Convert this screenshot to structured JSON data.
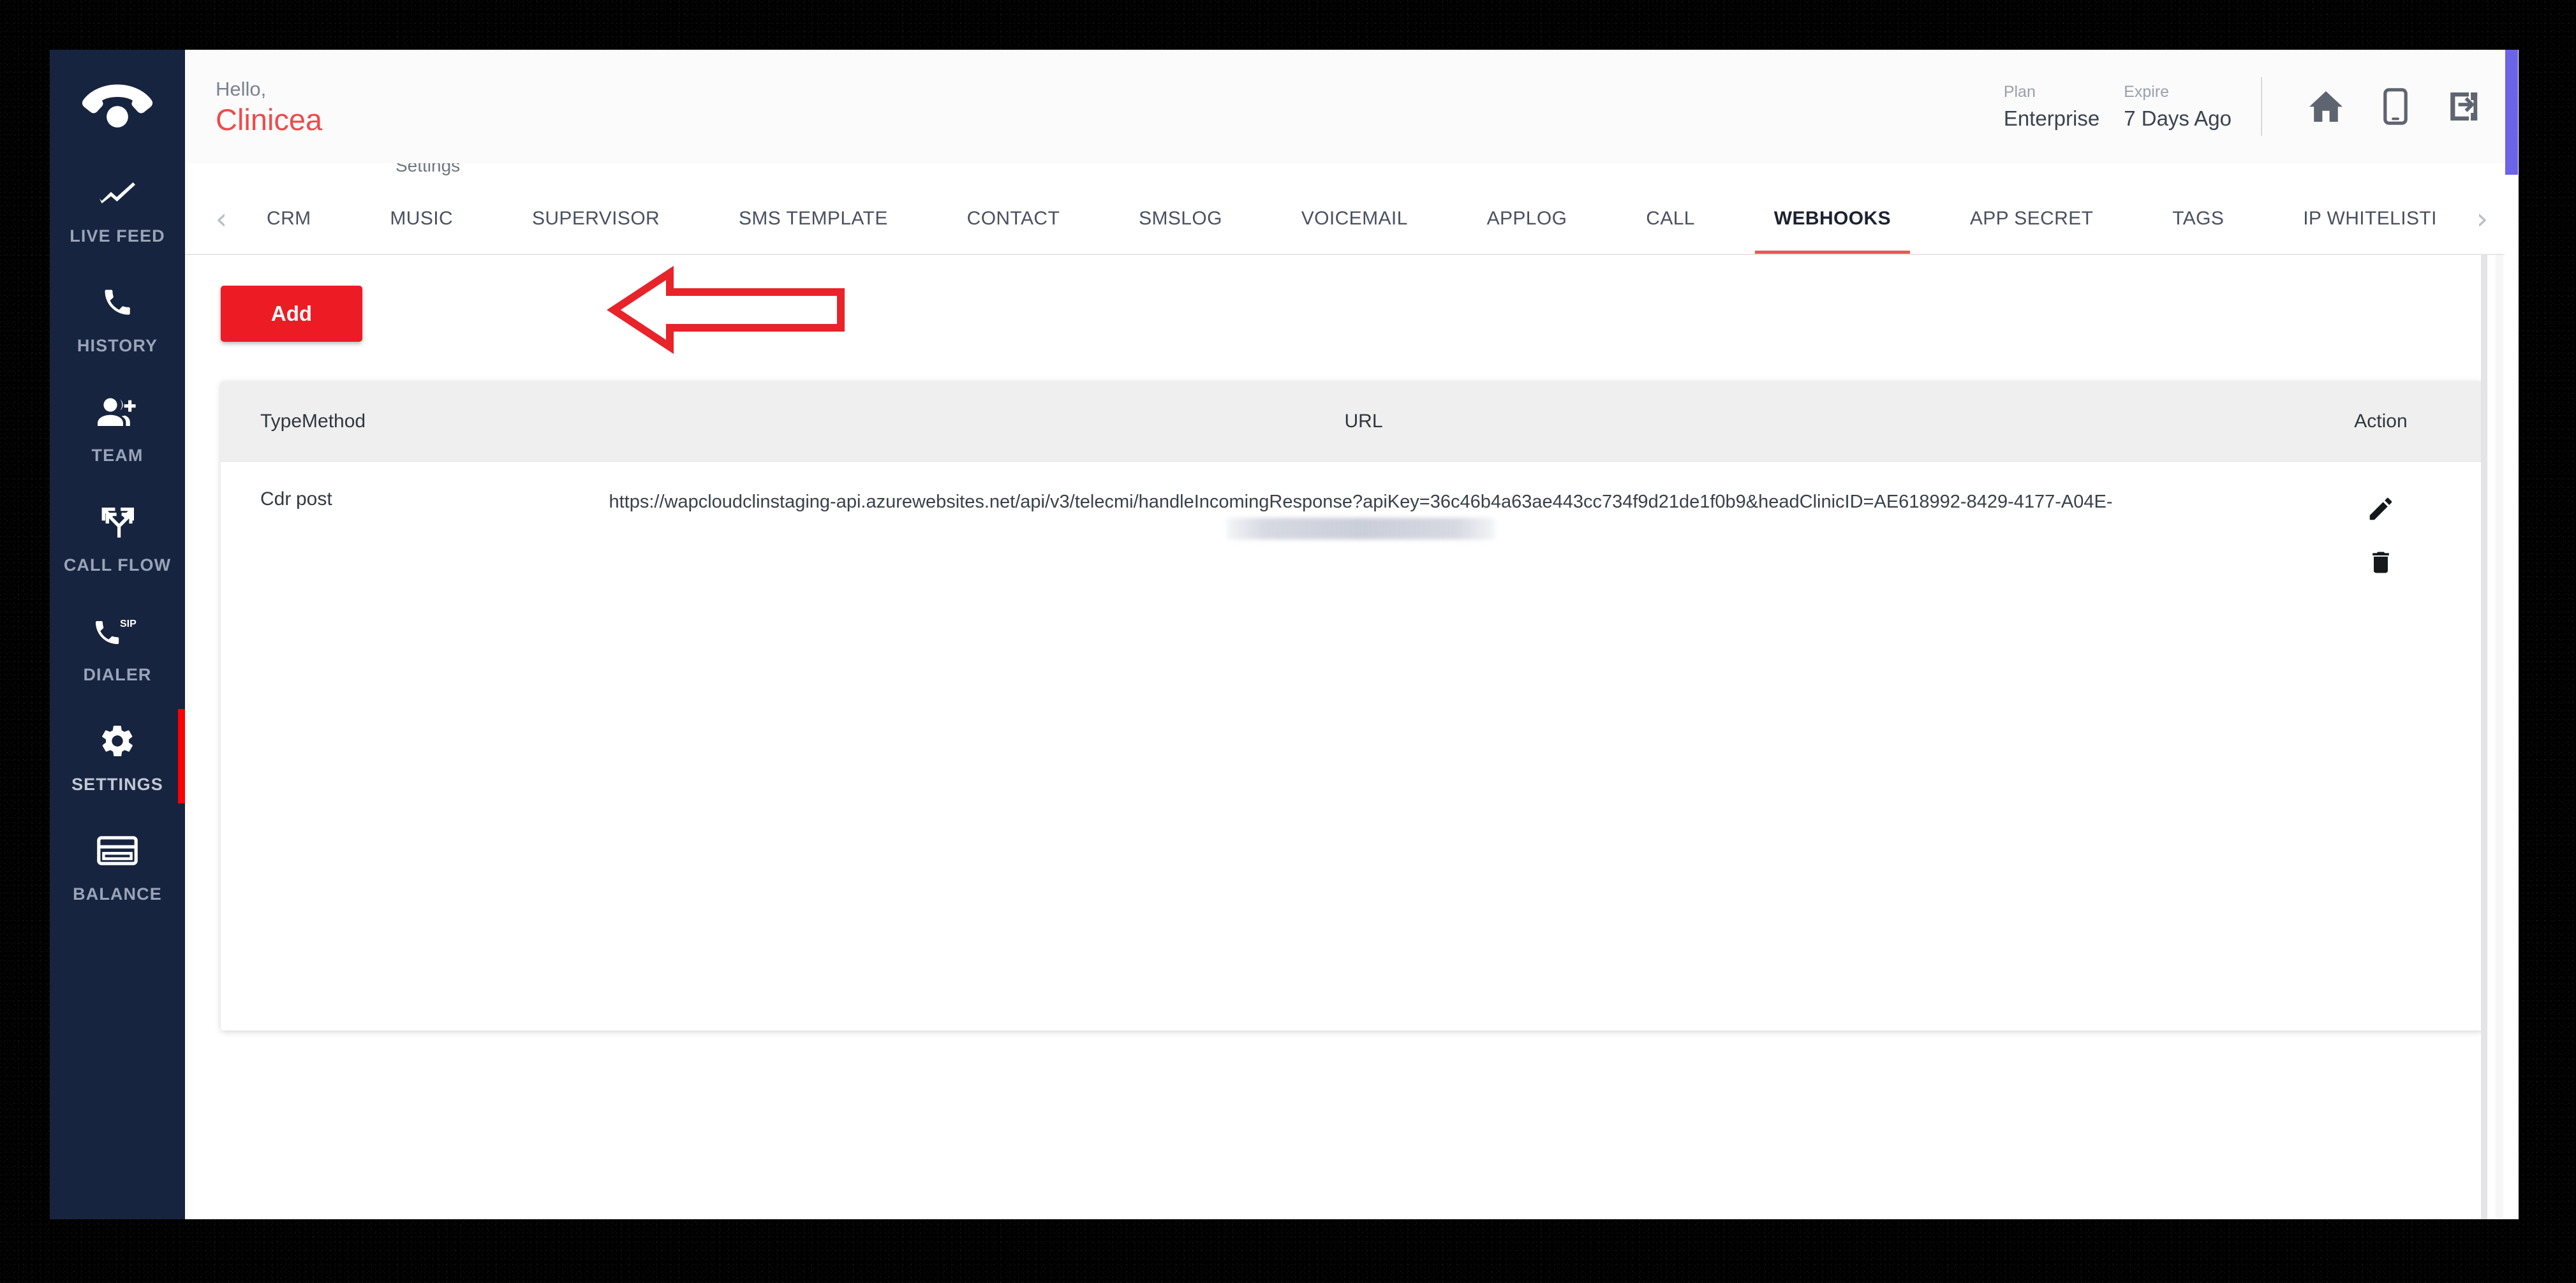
{
  "sidebar": {
    "logo_icon": "phone-handset-icon",
    "items": [
      {
        "label": "LIVE FEED",
        "icon": "trending-line-icon",
        "active": false
      },
      {
        "label": "HISTORY",
        "icon": "phone-icon",
        "active": false
      },
      {
        "label": "TEAM",
        "icon": "person-add-icon",
        "active": false
      },
      {
        "label": "CALL FLOW",
        "icon": "call-split-icon",
        "active": false
      },
      {
        "label": "DIALER",
        "icon": "sip-phone-icon",
        "active": false
      },
      {
        "label": "SETTINGS",
        "icon": "gear-icon",
        "active": true
      },
      {
        "label": "BALANCE",
        "icon": "credit-card-icon",
        "active": false
      }
    ],
    "bg_color": "#17243F",
    "active_indicator_color": "#FB0004"
  },
  "header": {
    "greeting_prefix": "Hello,",
    "account_name": "Clinicea",
    "account_name_color": "#EF4A4A",
    "plan_label": "Plan",
    "plan_value": "Enterprise",
    "expire_label": "Expire",
    "expire_value": "7 Days Ago",
    "icons": [
      {
        "name": "home-icon"
      },
      {
        "name": "mobile-icon"
      },
      {
        "name": "logout-icon"
      }
    ]
  },
  "breadcrumb": "Settings",
  "tabs": {
    "prev_arrow": "‹",
    "next_arrow": "›",
    "active": "WEBHOOKS",
    "active_underline_color": "#F0574F",
    "items": [
      {
        "label": "CRM"
      },
      {
        "label": "MUSIC"
      },
      {
        "label": "SUPERVISOR"
      },
      {
        "label": "SMS TEMPLATE"
      },
      {
        "label": "CONTACT"
      },
      {
        "label": "SMSLOG"
      },
      {
        "label": "VOICEMAIL"
      },
      {
        "label": "APPLOG"
      },
      {
        "label": "CALL"
      },
      {
        "label": "WEBHOOKS"
      },
      {
        "label": "APP SECRET"
      },
      {
        "label": "TAGS"
      },
      {
        "label": "IP WHITELISTI"
      }
    ]
  },
  "content": {
    "add_button_label": "Add",
    "add_button_color": "#ED1B24",
    "annotation": {
      "type": "arrow-left-outline",
      "color": "#E8232A"
    },
    "table": {
      "columns": [
        "Type",
        "Method",
        "URL",
        "Action"
      ],
      "rows": [
        {
          "type": "Cdr",
          "method": "post",
          "url": "https://wapcloudclinstaging-api.azurewebsites.net/api/v3/telecmi/handleIncomingResponse?apiKey=36c46b4a63ae443cc734f9d21de1f0b9&headClinicID=AE618992-8429-4177-A04E-",
          "url_redacted_tail": true,
          "actions": [
            {
              "name": "edit-icon"
            },
            {
              "name": "delete-icon"
            }
          ]
        }
      ]
    }
  },
  "scrollbar": {
    "outer_thumb_color": "#6B63E8",
    "inner_thumb_color": "#E4E4E6"
  }
}
